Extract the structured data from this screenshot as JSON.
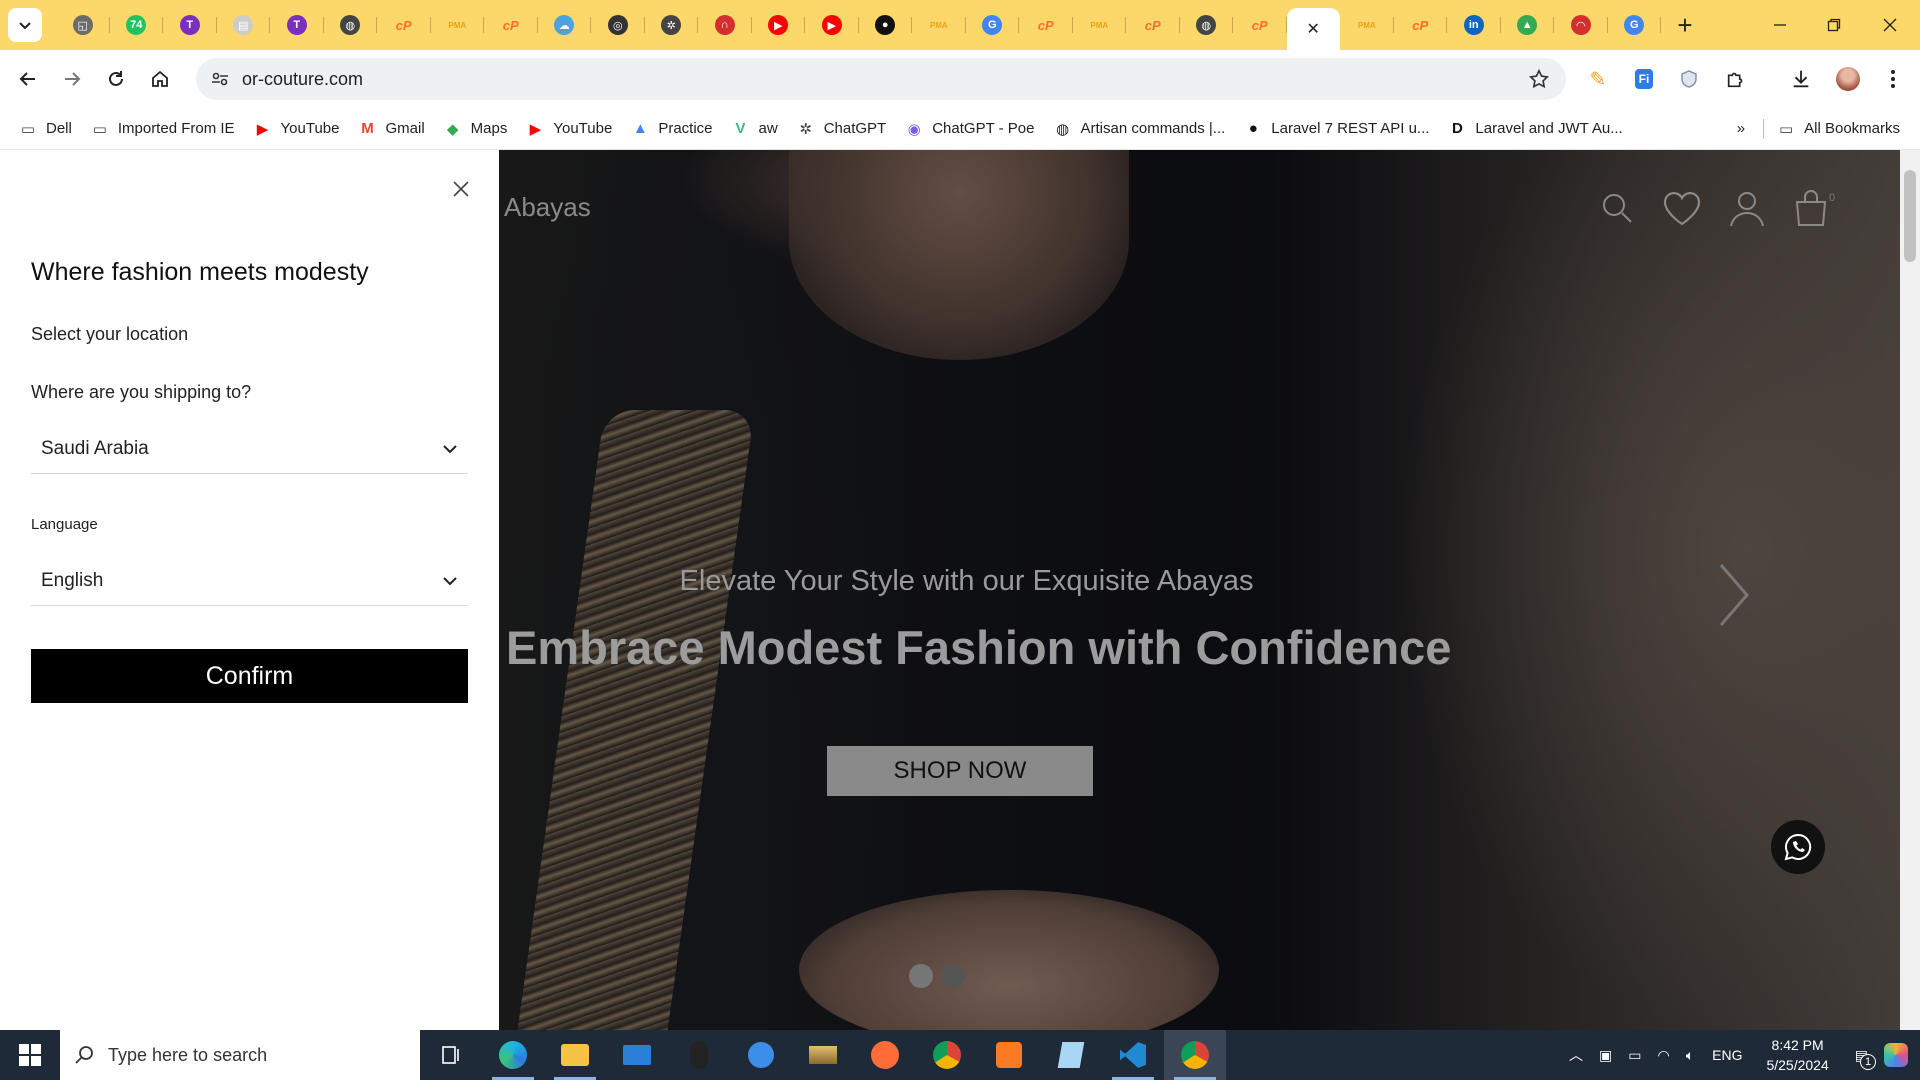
{
  "browser": {
    "tabs": [
      {
        "icon": "tab-icon",
        "color": "#6b6b6b",
        "glyph": "◱"
      },
      {
        "icon": "whatsapp-badge-icon",
        "color": "#22c35e",
        "glyph": "74"
      },
      {
        "icon": "t-logo-icon",
        "color": "#7b2fbf",
        "glyph": "T"
      },
      {
        "icon": "page-icon",
        "color": "#cccccc",
        "glyph": "▤"
      },
      {
        "icon": "t-logo-icon",
        "color": "#7b2fbf",
        "glyph": "T"
      },
      {
        "icon": "globe-icon",
        "color": "#444444",
        "glyph": "◍"
      },
      {
        "icon": "cpanel-icon",
        "color": "#ff6c2c",
        "glyph": "cP"
      },
      {
        "icon": "phpmyadmin-icon",
        "color": "#e8a317",
        "glyph": "PMA"
      },
      {
        "icon": "cpanel-icon",
        "color": "#ff6c2c",
        "glyph": "cP"
      },
      {
        "icon": "cloud-icon",
        "color": "#4aa3df",
        "glyph": "☁"
      },
      {
        "icon": "ring-icon",
        "color": "#333333",
        "glyph": "◎"
      },
      {
        "icon": "openai-icon",
        "color": "#444444",
        "glyph": "✲"
      },
      {
        "icon": "magnet-icon",
        "color": "#d32f2f",
        "glyph": "∩"
      },
      {
        "icon": "youtube-icon",
        "color": "#ff0000",
        "glyph": "▶"
      },
      {
        "icon": "youtube-icon",
        "color": "#ff0000",
        "glyph": "▶"
      },
      {
        "icon": "github-icon",
        "color": "#111111",
        "glyph": "●"
      },
      {
        "icon": "phpmyadmin-icon",
        "color": "#e8a317",
        "glyph": "PMA"
      },
      {
        "icon": "translate-icon",
        "color": "#4285f4",
        "glyph": "G"
      },
      {
        "icon": "cpanel-icon",
        "color": "#ff6c2c",
        "glyph": "cP"
      },
      {
        "icon": "phpmyadmin-icon",
        "color": "#e8a317",
        "glyph": "PMA"
      },
      {
        "icon": "cpanel-icon",
        "color": "#ff6c2c",
        "glyph": "cP"
      },
      {
        "icon": "globe-icon",
        "color": "#444444",
        "glyph": "◍"
      },
      {
        "icon": "cpanel-icon",
        "color": "#ff6c2c",
        "glyph": "cP"
      },
      {
        "icon": "close-icon",
        "color": "#222222",
        "glyph": "✕",
        "active": true
      },
      {
        "icon": "phpmyadmin-icon",
        "color": "#e8a317",
        "glyph": "PMA"
      },
      {
        "icon": "cpanel-icon",
        "color": "#ff6c2c",
        "glyph": "cP"
      },
      {
        "icon": "linkedin-icon",
        "color": "#0a66c2",
        "glyph": "in"
      },
      {
        "icon": "drive-icon",
        "color": "#34a853",
        "glyph": "▲"
      },
      {
        "icon": "gauge-icon",
        "color": "#d32f2f",
        "glyph": "◠"
      },
      {
        "icon": "google-icon",
        "color": "#4285f4",
        "glyph": "G"
      }
    ],
    "new_tab": "+",
    "url": "or-couture.com",
    "bookmarks": [
      {
        "label": "Dell",
        "icon": "folder-icon"
      },
      {
        "label": "Imported From IE",
        "icon": "folder-icon"
      },
      {
        "label": "YouTube",
        "icon": "youtube-icon"
      },
      {
        "label": "Gmail",
        "icon": "gmail-icon"
      },
      {
        "label": "Maps",
        "icon": "maps-icon"
      },
      {
        "label": "YouTube",
        "icon": "youtube-icon"
      },
      {
        "label": "Practice",
        "icon": "rocket-icon"
      },
      {
        "label": "aw",
        "icon": "vue-icon"
      },
      {
        "label": "ChatGPT",
        "icon": "openai-icon"
      },
      {
        "label": "ChatGPT - Poe",
        "icon": "poe-icon"
      },
      {
        "label": "Artisan commands |...",
        "icon": "globe-icon"
      },
      {
        "label": "Laravel 7 REST API u...",
        "icon": "medium-icon"
      },
      {
        "label": "Laravel and JWT Au...",
        "icon": "dev-icon"
      }
    ],
    "more_bookmarks": "»",
    "all_bookmarks": "All Bookmarks"
  },
  "modal": {
    "title": "Where fashion meets modesty",
    "select_location": "Select your location",
    "shipping_question": "Where are you shipping to?",
    "country": "Saudi Arabia",
    "language_label": "Language",
    "language": "English",
    "confirm": "Confirm"
  },
  "hero": {
    "brand": "Abayas",
    "subtitle": "Elevate Your Style with our Exquisite Abayas",
    "headline": "Embrace Modest Fashion with Confidence",
    "cta": "SHOP NOW",
    "cart_count": "0",
    "slides": 2,
    "active_slide": 1
  },
  "taskbar": {
    "search_placeholder": "Type here to search",
    "language": "ENG",
    "time": "8:42 PM",
    "date": "5/25/2024",
    "notifications": "1"
  }
}
